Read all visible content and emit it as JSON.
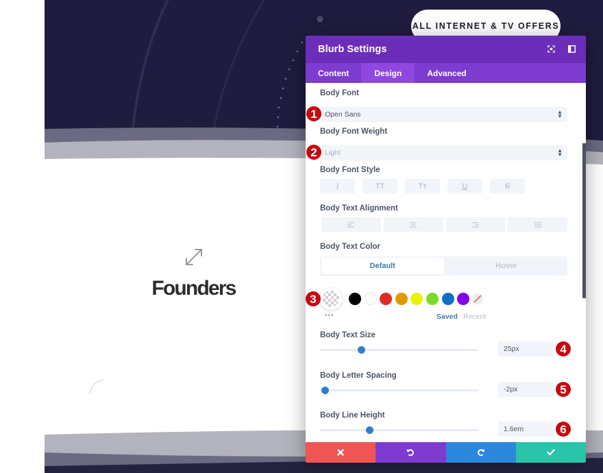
{
  "background": {
    "cta_label": "ALL INTERNET & TV OFFERS",
    "module_title": "Founders",
    "colors": {
      "dark": "#1f1c3f",
      "wave_mid": "#6b6a80",
      "wave_light": "#b3b3bd"
    }
  },
  "modal": {
    "title": "Blurb Settings",
    "header_icons": [
      "focus-mode-icon",
      "sidebar-layout-icon"
    ],
    "tabs": [
      {
        "label": "Content",
        "active": false
      },
      {
        "label": "Design",
        "active": true
      },
      {
        "label": "Advanced",
        "active": false
      }
    ],
    "fields": {
      "body_font": {
        "label": "Body Font",
        "value": "Open Sans",
        "badge": "1"
      },
      "body_font_weight": {
        "label": "Body Font Weight",
        "value": "Light",
        "badge": "2"
      },
      "body_font_style": {
        "label": "Body Font Style",
        "buttons": [
          "I",
          "TT",
          "Tт",
          "U",
          "S"
        ],
        "button_names": [
          "italic",
          "uppercase",
          "capitalize",
          "underline",
          "strikethrough"
        ]
      },
      "body_text_alignment": {
        "label": "Body Text Alignment",
        "buttons": [
          "left",
          "center",
          "right",
          "justify"
        ]
      },
      "body_text_color": {
        "label": "Body Text Color",
        "toggle": [
          "Default",
          "Hover"
        ],
        "badge": "3",
        "swatches": [
          "#000000",
          "#ffffff",
          "#e02b20",
          "#e09900",
          "#edf000",
          "#7cda24",
          "#0c71c3",
          "#8300e9"
        ],
        "saved_label": "Saved",
        "recent_label": "Recent",
        "more": "•••"
      },
      "body_text_size": {
        "label": "Body Text Size",
        "value": "25px",
        "slider_fraction": 0.26,
        "badge": "4"
      },
      "body_letter_spacing": {
        "label": "Body Letter Spacing",
        "value": "-2px",
        "slider_fraction": 0.03,
        "badge": "5"
      },
      "body_line_height": {
        "label": "Body Line Height",
        "value": "1.6em",
        "slider_fraction": 0.31,
        "badge": "6"
      }
    },
    "footer": [
      {
        "name": "cancel",
        "icon": "✖",
        "color": "#ef5555"
      },
      {
        "name": "undo",
        "icon": "↺",
        "color": "#7e3bd0"
      },
      {
        "name": "redo",
        "icon": "↻",
        "color": "#2b87da"
      },
      {
        "name": "save",
        "icon": "✔",
        "color": "#29c4a9"
      }
    ],
    "colors": {
      "header": "#6c2eb9",
      "tabs": "#7e3bd0",
      "active_tab": "#8f47e0",
      "accent_blue": "#2e7fd1",
      "badge": "#c7090f"
    }
  }
}
